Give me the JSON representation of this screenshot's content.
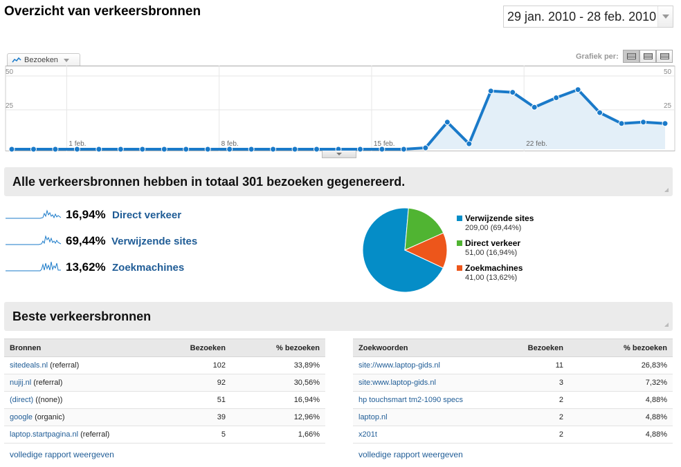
{
  "header": {
    "title": "Overzicht van verkeersbronnen",
    "date_range": "29 jan. 2010 - 28 feb. 2010"
  },
  "graph": {
    "metric_tab": "Bezoeken",
    "graph_by_label": "Grafiek per:",
    "y_ticks_left": [
      "50",
      "25"
    ],
    "y_ticks_right": [
      "50",
      "25"
    ],
    "x_ticks": [
      "1 feb.",
      "8 feb.",
      "15 feb.",
      "22 feb."
    ]
  },
  "chart_data": {
    "type": "area",
    "title": "",
    "xlabel": "",
    "ylabel": "Bezoeken",
    "ylim": [
      0,
      50
    ],
    "x": [
      "29 jan.",
      "30 jan.",
      "31 jan.",
      "1 feb.",
      "2 feb.",
      "3 feb.",
      "4 feb.",
      "5 feb.",
      "6 feb.",
      "7 feb.",
      "8 feb.",
      "9 feb.",
      "10 feb.",
      "11 feb.",
      "12 feb.",
      "13 feb.",
      "14 feb.",
      "15 feb.",
      "16 feb.",
      "17 feb.",
      "18 feb.",
      "19 feb.",
      "20 feb.",
      "21 feb.",
      "22 feb.",
      "23 feb.",
      "24 feb.",
      "25 feb.",
      "26 feb.",
      "27 feb.",
      "28 feb."
    ],
    "series": [
      {
        "name": "Bezoeken",
        "values": [
          0,
          0,
          0,
          0,
          0,
          0,
          0,
          0,
          0,
          0,
          0,
          0,
          0,
          0,
          0,
          0,
          0,
          0,
          0,
          1,
          20,
          4,
          43,
          42,
          31,
          38,
          44,
          27,
          19,
          20,
          19
        ]
      }
    ],
    "grid": true,
    "color": "#1a7ac9"
  },
  "summary": {
    "heading": "Alle verkeersbronnen hebben in totaal 301 bezoeken gegenereerd.",
    "sources": [
      {
        "pct": "16,94%",
        "label": "Direct verkeer"
      },
      {
        "pct": "69,44%",
        "label": "Verwijzende sites"
      },
      {
        "pct": "13,62%",
        "label": "Zoekmachines"
      }
    ]
  },
  "pie": {
    "type": "pie",
    "slices": [
      {
        "name": "Verwijzende sites",
        "value": 209,
        "value_text": "209,00 (69,44%)",
        "color": "#058dc7"
      },
      {
        "name": "Direct verkeer",
        "value": 51,
        "value_text": "51,00 (16,94%)",
        "color": "#50b432"
      },
      {
        "name": "Zoekmachines",
        "value": 41,
        "value_text": "41,00 (13,62%)",
        "color": "#ed561b"
      }
    ]
  },
  "top_sources": {
    "heading": "Beste verkeersbronnen",
    "sources_table": {
      "headers": [
        "Bronnen",
        "Bezoeken",
        "% bezoeken"
      ],
      "rows": [
        {
          "link": "sitedeals.nl",
          "type": " (referral)",
          "visits": "102",
          "pct": "33,89%"
        },
        {
          "link": "nujij.nl",
          "type": " (referral)",
          "visits": "92",
          "pct": "30,56%"
        },
        {
          "link": "(direct)",
          "type": " ((none))",
          "visits": "51",
          "pct": "16,94%"
        },
        {
          "link": "google",
          "type": " (organic)",
          "visits": "39",
          "pct": "12,96%"
        },
        {
          "link": "laptop.startpagina.nl",
          "type": " (referral)",
          "visits": "5",
          "pct": "1,66%"
        }
      ],
      "full_report": "volledige rapport weergeven"
    },
    "keywords_table": {
      "headers": [
        "Zoekwoorden",
        "Bezoeken",
        "% bezoeken"
      ],
      "rows": [
        {
          "link": "site://www.laptop-gids.nl",
          "visits": "11",
          "pct": "26,83%"
        },
        {
          "link": "site:www.laptop-gids.nl",
          "visits": "3",
          "pct": "7,32%"
        },
        {
          "link": "hp touchsmart tm2-1090 specs",
          "visits": "2",
          "pct": "4,88%"
        },
        {
          "link": "laptop.nl",
          "visits": "2",
          "pct": "4,88%"
        },
        {
          "link": "x201t",
          "visits": "2",
          "pct": "4,88%"
        }
      ],
      "full_report": "volledige rapport weergeven"
    }
  }
}
